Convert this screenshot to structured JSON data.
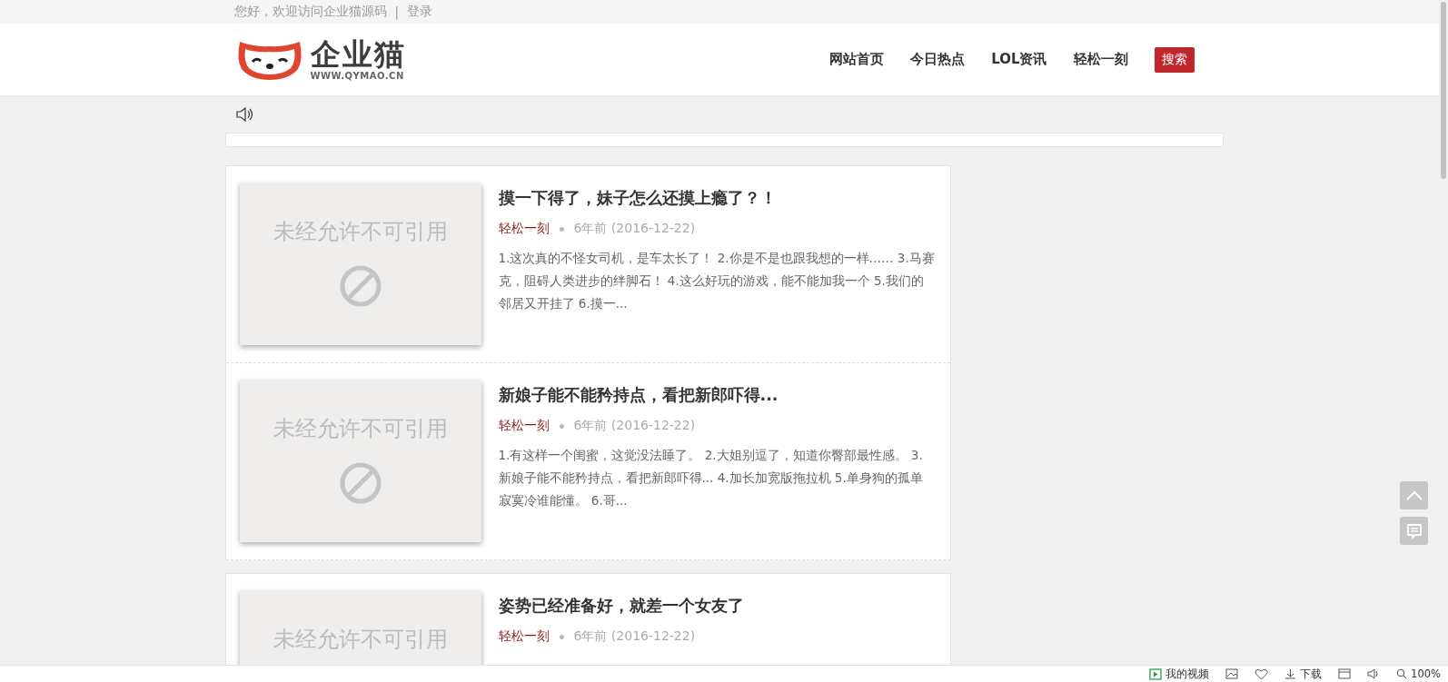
{
  "topbar": {
    "greeting": "您好，欢迎访问企业猫源码",
    "separator": "|",
    "login": "登录"
  },
  "header": {
    "logo_name": "企业猫",
    "logo_url": "WWW.QYMAO.CN",
    "nav": [
      {
        "label": "网站首页",
        "kind": "link"
      },
      {
        "label": "今日热点",
        "kind": "link"
      },
      {
        "label": "LOL资讯",
        "kind": "link"
      },
      {
        "label": "轻松一刻",
        "kind": "link"
      },
      {
        "label": "搜索",
        "kind": "button"
      }
    ]
  },
  "article_cards": [
    {
      "articles": [
        {
          "title": "摸一下得了，妹子怎么还摸上瘾了？！",
          "thumb_text": "未经允许不可引用",
          "thumb_icon": true,
          "category": "轻松一刻",
          "date": "6年前 (2016-12-22)",
          "excerpt": "1.这次真的不怪女司机，是车太长了！ 2.你是不是也跟我想的一样…… 3.马赛克，阻碍人类进步的绊脚石！ 4.这么好玩的游戏，能不能加我一个 5.我们的邻居又开挂了 6.摸一..."
        },
        {
          "title": "新娘子能不能矜持点，看把新郎吓得...",
          "thumb_text": "未经允许不可引用",
          "thumb_icon": true,
          "category": "轻松一刻",
          "date": "6年前 (2016-12-22)",
          "excerpt": "1.有这样一个闺蜜，这觉没法睡了。 2.大姐别逗了，知道你臀部最性感。 3.新娘子能不能矜持点，看把新郎吓得... 4.加长加宽版拖拉机 5.单身狗的孤单寂寞冷谁能懂。 6.哥..."
        }
      ]
    },
    {
      "articles": [
        {
          "title": "姿势已经准备好，就差一个女友了",
          "thumb_text": "未经允许不可引用",
          "category": "轻松一刻",
          "date": "6年前 (2016-12-22)"
        }
      ]
    }
  ],
  "status_bar": {
    "video_label": "我的视频",
    "download_label": "下载",
    "zoom": "100%"
  }
}
